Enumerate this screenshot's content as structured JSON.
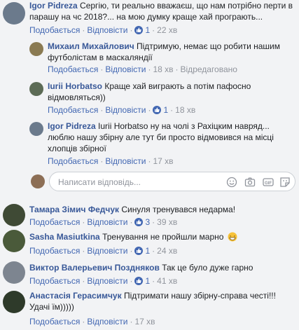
{
  "thread": [
    {
      "name": "Igor Pidreza",
      "text_line1": "Сергію, ти реально вважаєш, що нам потрібно перти в",
      "text_line2": "парашу на чс 2018?... на мою думку краще хай програють...",
      "like": "Подобається",
      "reply": "Відповісти",
      "likes": "1",
      "time": "22 хв",
      "avatar_color": "#6b7a8c"
    },
    {
      "name": "Михаил Михайлович",
      "text_line1": "Підтримую, немає що робити нашим",
      "text_line2": "футболістам в маскаляндії",
      "like": "Подобається",
      "reply": "Відповісти",
      "time": "18 хв",
      "edited": "Відредаговано",
      "avatar_color": "#8a7a52"
    },
    {
      "name": "Iurii Horbatso",
      "text_line1": "Краще хай виграють а потім пафосно",
      "text_line2": "відмовляться))",
      "like": "Подобається",
      "reply": "Відповісти",
      "likes": "1",
      "time": "18 хв",
      "avatar_color": "#5c6b55"
    },
    {
      "name": "Igor Pidreza",
      "text_line1": "Iurii Horbatso ну на чолі з Рахіцким навряд...",
      "text_line2": "люблю нашу збірну але тут би просто відмовився на місці",
      "text_line3": "хлопців збірної",
      "like": "Подобається",
      "reply": "Відповісти",
      "time": "17 хв",
      "avatar_color": "#6b7a8c"
    }
  ],
  "reply_box": {
    "placeholder": "Написати відповідь..."
  },
  "comments": [
    {
      "name": "Тамара Зімич Федчук",
      "text": "Синуля тренувався недарма!",
      "like": "Подобається",
      "reply": "Відповісти",
      "likes": "3",
      "time": "39 хв",
      "avatar_color": "#3f4a35"
    },
    {
      "name": "Sasha Masiutkina",
      "text": "Тренування не пройшли марно",
      "like": "Подобається",
      "reply": "Відповісти",
      "likes": "1",
      "time": "24 хв",
      "avatar_color": "#4a5a3a"
    },
    {
      "name": "Виктор Валерьевич Поздняков",
      "text": "Так це було дуже гарно",
      "like": "Подобається",
      "reply": "Відповісти",
      "likes": "1",
      "time": "41 хв",
      "avatar_color": "#7d8590"
    },
    {
      "name": "Анастасія Герасимчук",
      "text_line1": "Підтримати нашу збірну-справа честі!!!",
      "text_line2": "Удачі їм)))))",
      "like": "Подобається",
      "reply": "Відповісти",
      "time": "17 хв",
      "avatar_color": "#2e3a2a"
    }
  ]
}
